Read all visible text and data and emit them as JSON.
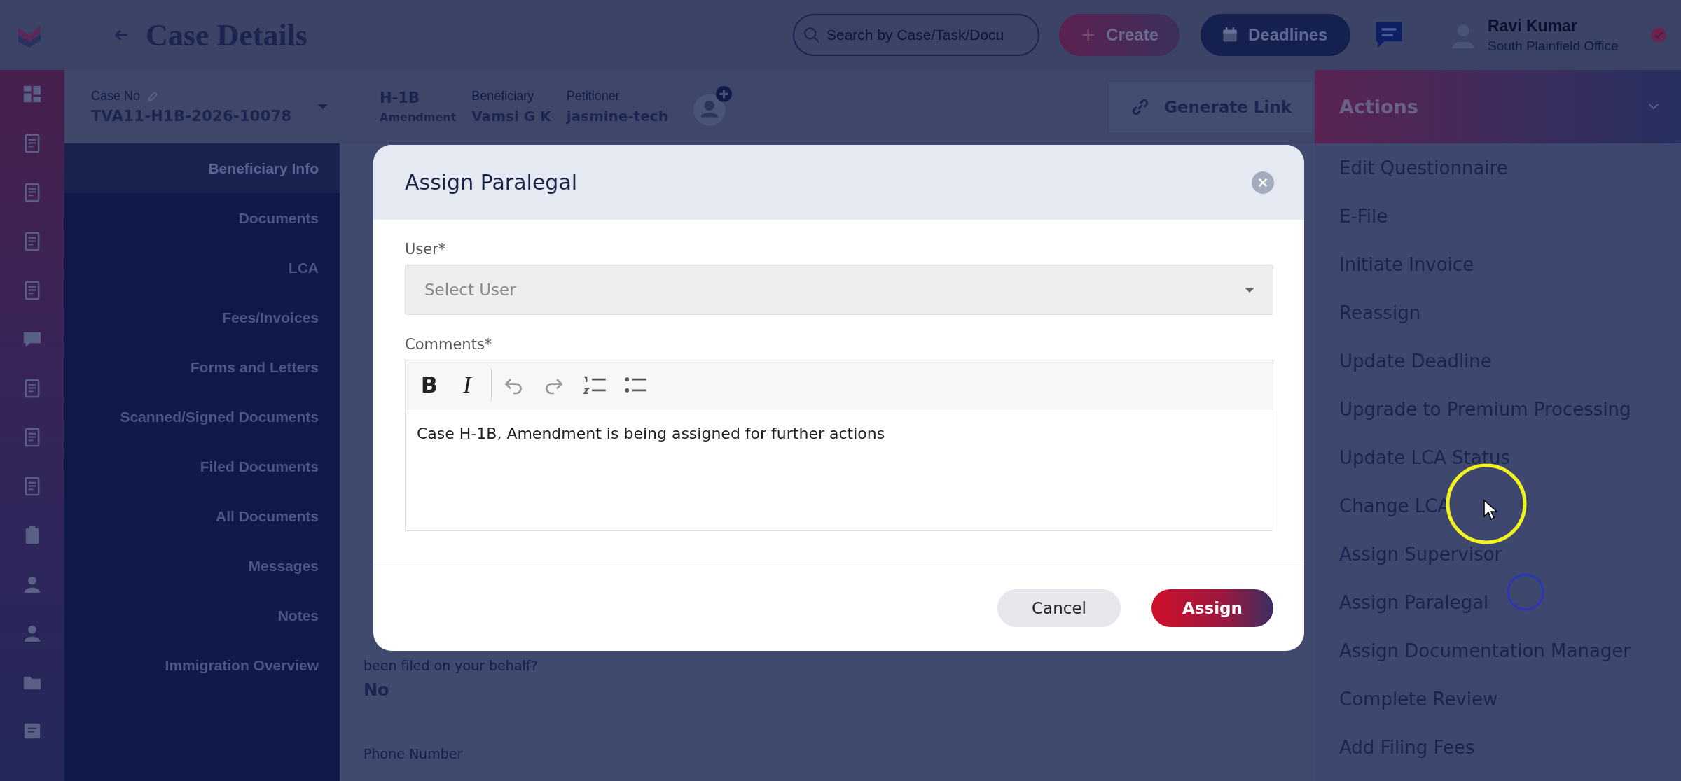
{
  "header": {
    "title": "Case Details",
    "search": {
      "placeholder": "Search by Case/Task/Docu"
    },
    "buttons": [
      {
        "label": "Create",
        "kind": "create"
      },
      {
        "label": "Deadlines",
        "kind": "deadlines"
      }
    ],
    "user": {
      "name": "Ravi Kumar",
      "office": "South Plainfield Office"
    }
  },
  "case": {
    "case_no_label": "Case No",
    "case_no": "TVA11-H1B-2026-10078",
    "visa": "H-1B",
    "visa_type": "Amendment",
    "fields": [
      {
        "label": "Beneficiary",
        "value": "Vamsi G K"
      },
      {
        "label": "Petitioner",
        "value": "jasmine-tech"
      }
    ],
    "generate_link": "Generate Link"
  },
  "sidebar": {
    "items": [
      {
        "label": "Beneficiary Info",
        "selected": true
      },
      {
        "label": "Documents",
        "selected": false
      },
      {
        "label": "LCA",
        "selected": false
      },
      {
        "label": "Fees/Invoices",
        "selected": false
      },
      {
        "label": "Forms and Letters",
        "selected": false
      },
      {
        "label": "Scanned/Signed Documents",
        "selected": false
      },
      {
        "label": "Filed Documents",
        "selected": false
      },
      {
        "label": "All Documents",
        "selected": false
      },
      {
        "label": "Messages",
        "selected": false
      },
      {
        "label": "Notes",
        "selected": false
      },
      {
        "label": "Immigration Overview",
        "selected": false
      }
    ]
  },
  "content": {
    "question": "been filed on your behalf?",
    "answer": "No",
    "next_label": "Phone Number"
  },
  "actions": {
    "title": "Actions",
    "items": [
      "Edit Questionnaire",
      "E-File",
      "Initiate Invoice",
      "Reassign",
      "Update Deadline",
      "Upgrade to Premium Processing",
      "Update LCA Status",
      "Change LCA",
      "Assign Supervisor",
      "Assign Paralegal",
      "Assign Documentation Manager",
      "Complete Review",
      "Add Filing Fees"
    ]
  },
  "dialog": {
    "title": "Assign Paralegal",
    "user_label": "User*",
    "user_select": {
      "placeholder": "Select User"
    },
    "comments_label": "Comments*",
    "toolbar": [
      "B",
      "I"
    ],
    "comment": "Case H-1B, Amendment is being assigned for further actions",
    "buttons": [
      {
        "label": "Cancel",
        "kind": "secondary"
      },
      {
        "label": "Assign",
        "kind": "primary"
      }
    ]
  }
}
